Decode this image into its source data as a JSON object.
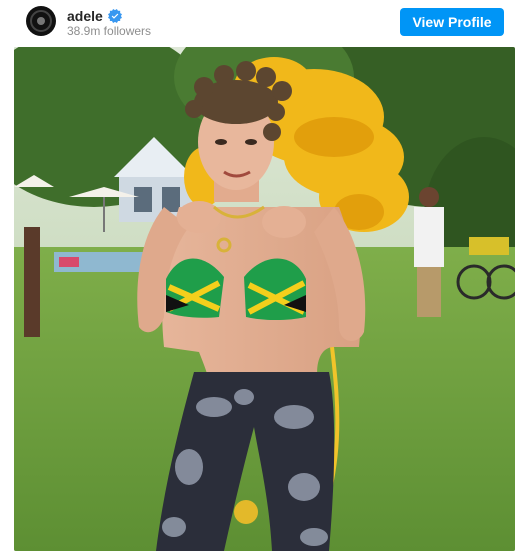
{
  "post": {
    "username": "adele",
    "followers": "38.9m followers",
    "view_profile_label": "View Profile",
    "verified": true
  },
  "icons": {
    "avatar": "profile-avatar",
    "verified": "verified-badge-icon"
  },
  "colors": {
    "button_blue": "#0095f6",
    "username": "#262626",
    "muted": "#8e8e8e",
    "verified_blue": "#3897f0"
  }
}
